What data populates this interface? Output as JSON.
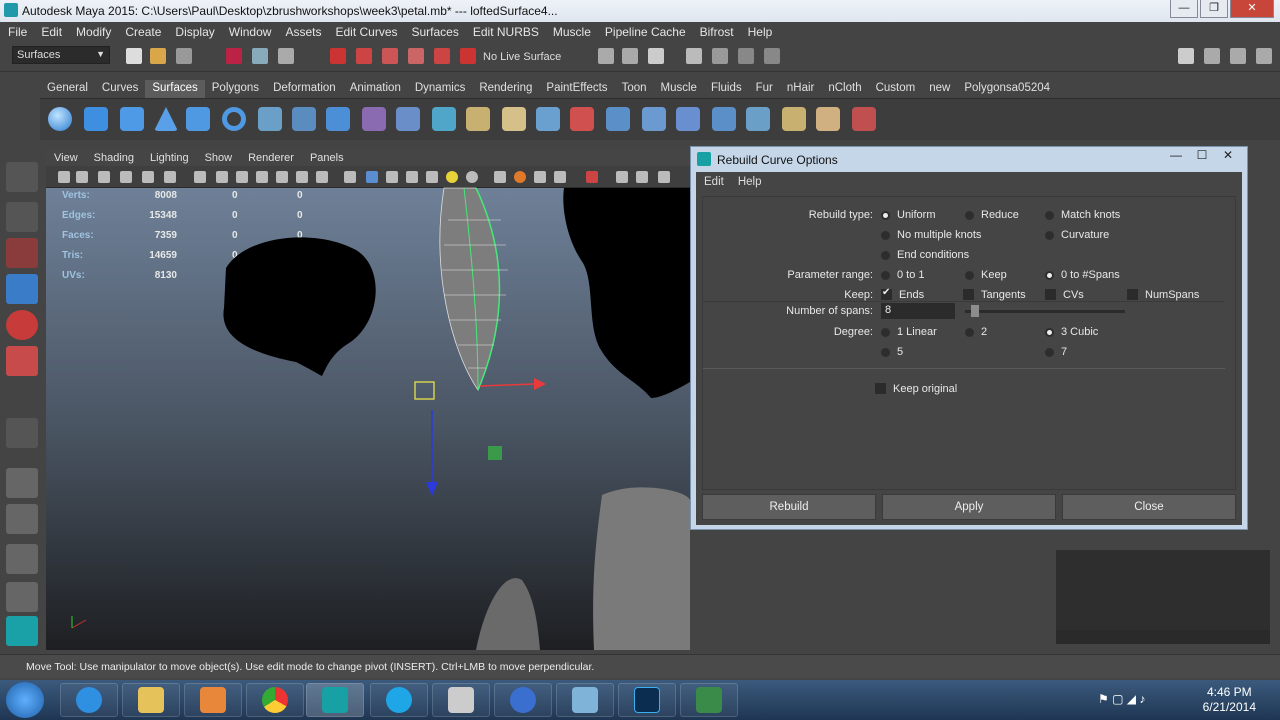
{
  "window": {
    "title": "Autodesk Maya 2015: C:\\Users\\Paul\\Desktop\\zbrushworkshops\\week3\\petal.mb*   ---   loftedSurface4..."
  },
  "menubar": [
    "File",
    "Edit",
    "Modify",
    "Create",
    "Display",
    "Window",
    "Assets",
    "Edit Curves",
    "Surfaces",
    "Edit NURBS",
    "Muscle",
    "Pipeline Cache",
    "Bifrost",
    "Help"
  ],
  "statusline": {
    "mode": "Surfaces",
    "live_surface": "No Live Surface"
  },
  "shelf": {
    "tabs": [
      "General",
      "Curves",
      "Surfaces",
      "Polygons",
      "Deformation",
      "Animation",
      "Dynamics",
      "Rendering",
      "PaintEffects",
      "Toon",
      "Muscle",
      "Fluids",
      "Fur",
      "nHair",
      "nCloth",
      "Custom",
      "new",
      "Polygonsa05204"
    ],
    "active_tab": "Surfaces"
  },
  "viewport": {
    "menu": [
      "View",
      "Shading",
      "Lighting",
      "Show",
      "Renderer",
      "Panels"
    ],
    "hud": [
      {
        "label": "Verts:",
        "v1": "8008",
        "v2": "0",
        "v3": "0"
      },
      {
        "label": "Edges:",
        "v1": "15348",
        "v2": "0",
        "v3": "0"
      },
      {
        "label": "Faces:",
        "v1": "7359",
        "v2": "0",
        "v3": "0"
      },
      {
        "label": "Tris:",
        "v1": "14659",
        "v2": "0",
        "v3": "0"
      },
      {
        "label": "UVs:",
        "v1": "8130",
        "v2": "0",
        "v3": "0"
      }
    ]
  },
  "dialog": {
    "title": "Rebuild Curve Options",
    "menu": [
      "Edit",
      "Help"
    ],
    "rebuild_type_label": "Rebuild type:",
    "rebuild_types": [
      "Uniform",
      "Reduce",
      "Match knots",
      "No multiple knots",
      "Curvature",
      "End conditions"
    ],
    "parameter_range_label": "Parameter range:",
    "parameter_ranges": [
      "0 to 1",
      "Keep",
      "0 to #Spans"
    ],
    "keep_label": "Keep:",
    "keep_options": [
      "Ends",
      "Tangents",
      "CVs",
      "NumSpans"
    ],
    "spans_label": "Number of spans:",
    "spans_value": "8",
    "degree_label": "Degree:",
    "degrees": [
      "1 Linear",
      "2",
      "3 Cubic",
      "5",
      "7"
    ],
    "keep_original": "Keep original",
    "buttons": {
      "rebuild": "Rebuild",
      "apply": "Apply",
      "close": "Close"
    }
  },
  "helpline": "Move Tool: Use manipulator to move object(s). Use edit mode to change pivot (INSERT).  Ctrl+LMB to move perpendicular.",
  "taskbar": {
    "time": "4:46 PM",
    "date": "6/21/2014"
  }
}
